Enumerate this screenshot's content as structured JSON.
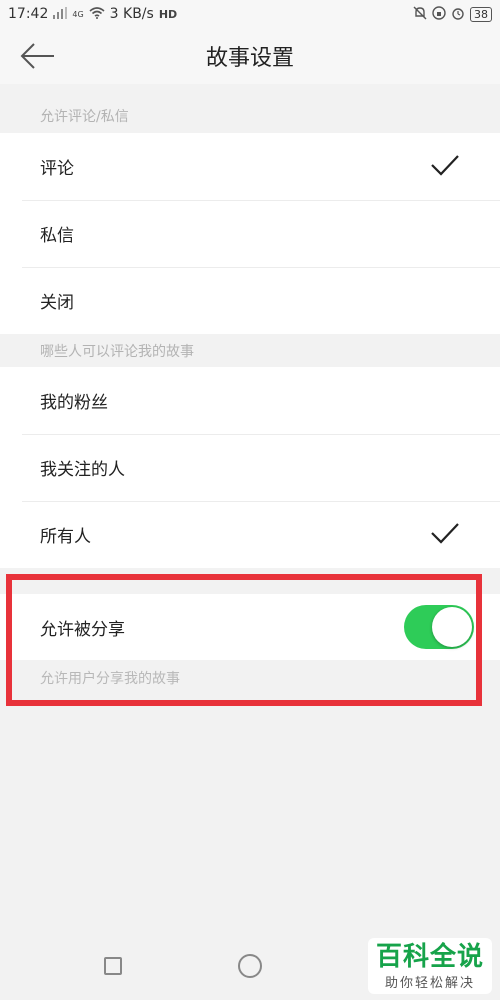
{
  "status_bar": {
    "time": "17:42",
    "signal": "4G",
    "speed": "3 KB/s",
    "hd": "HD",
    "battery": "38"
  },
  "header": {
    "title": "故事设置"
  },
  "section_comments": {
    "label": "允许评论/私信",
    "items": [
      {
        "label": "评论",
        "checked": true
      },
      {
        "label": "私信",
        "checked": false
      },
      {
        "label": "关闭",
        "checked": false
      }
    ]
  },
  "section_who": {
    "label": "哪些人可以评论我的故事",
    "items": [
      {
        "label": "我的粉丝",
        "checked": false
      },
      {
        "label": "我关注的人",
        "checked": false
      },
      {
        "label": "所有人",
        "checked": true
      }
    ]
  },
  "share": {
    "label": "允许被分享",
    "enabled": true,
    "description": "允许用户分享我的故事"
  },
  "watermark": {
    "main": "百科全说",
    "sub": "助你轻松解决"
  },
  "colors": {
    "toggle_on": "#2ecc58",
    "highlight": "#e8323a"
  }
}
